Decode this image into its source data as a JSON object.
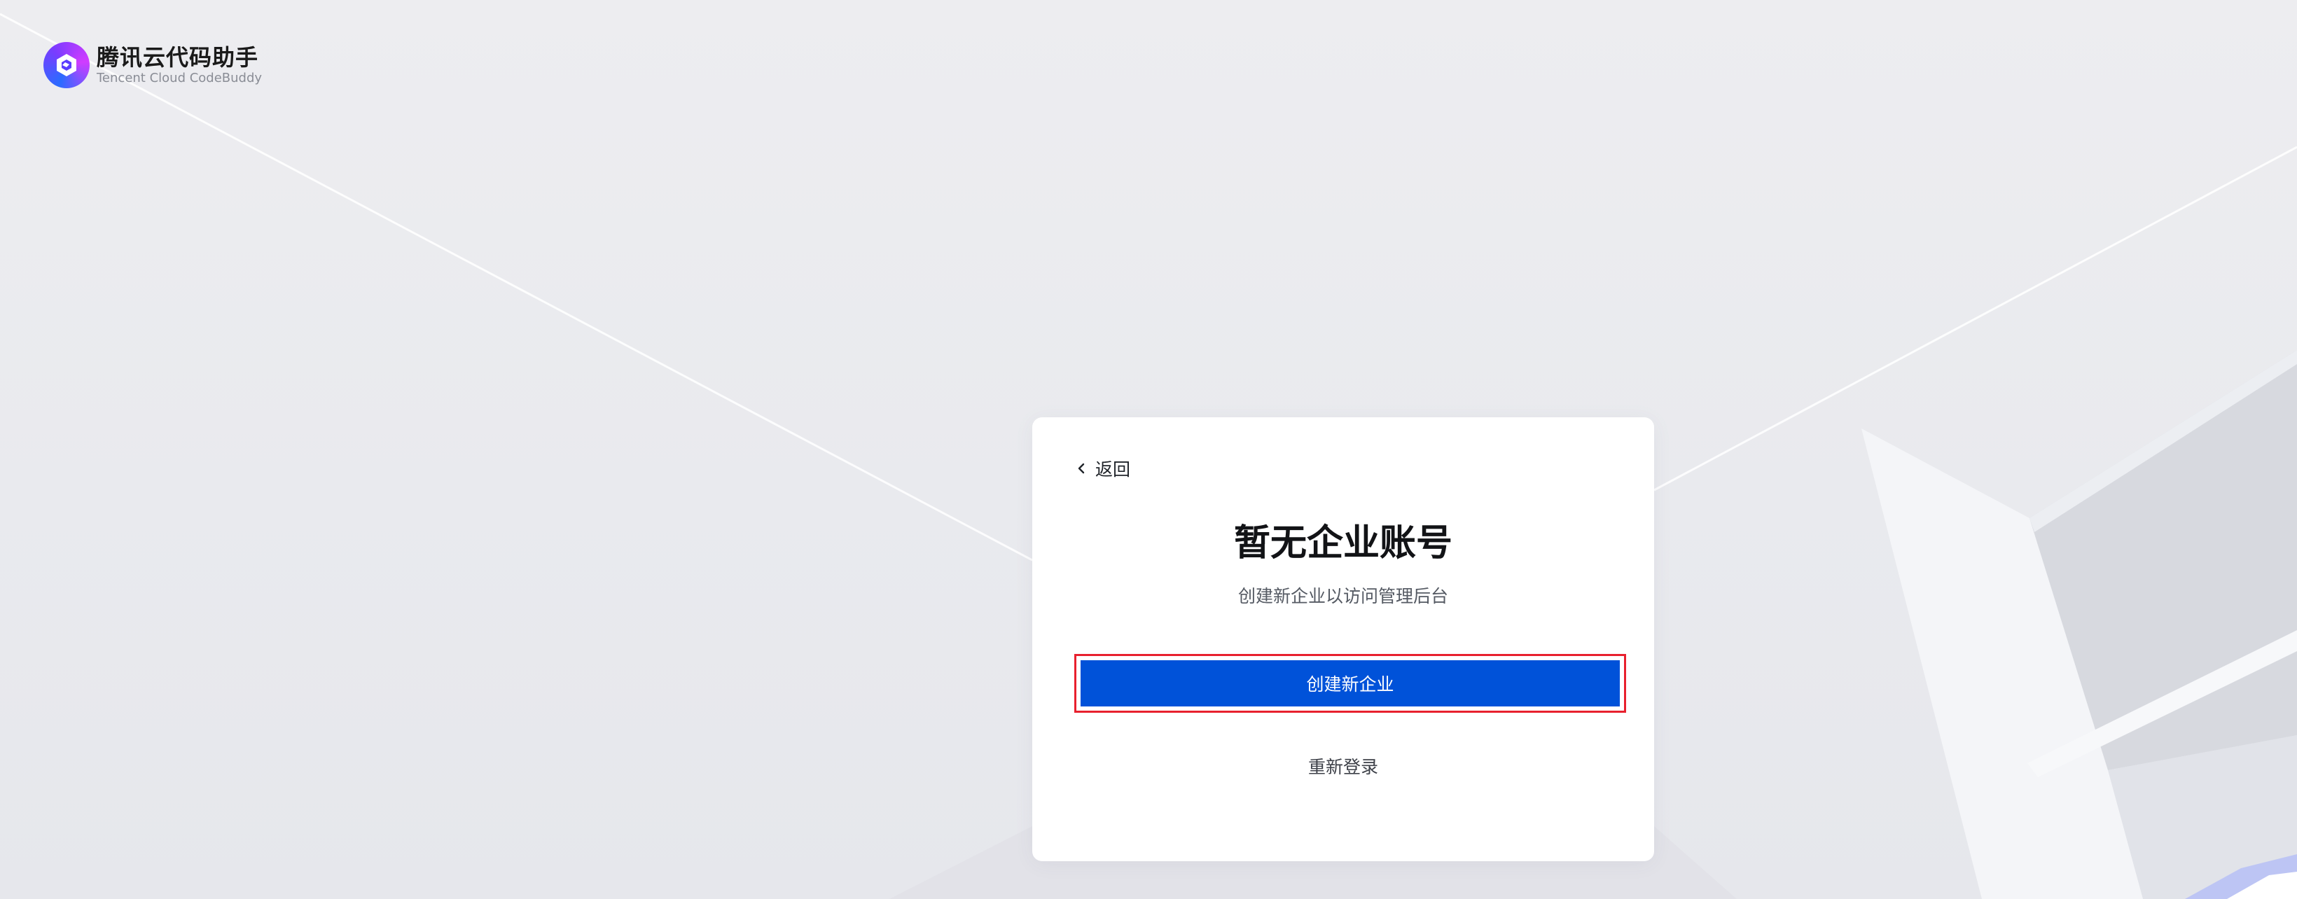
{
  "brand": {
    "name": "腾讯云代码助手",
    "subtitle": "Tencent Cloud CodeBuddy",
    "icon": "codebuddy-logo-icon"
  },
  "card": {
    "back_label": "返回",
    "back_icon": "chevron-left-icon",
    "title": "暂无企业账号",
    "subtitle": "创建新企业以访问管理后台",
    "primary_button_label": "创建新企业",
    "secondary_link_label": "重新登录"
  },
  "colors": {
    "primary": "#0052d9",
    "highlight_border": "#e8202e",
    "background": "#ececf0"
  }
}
